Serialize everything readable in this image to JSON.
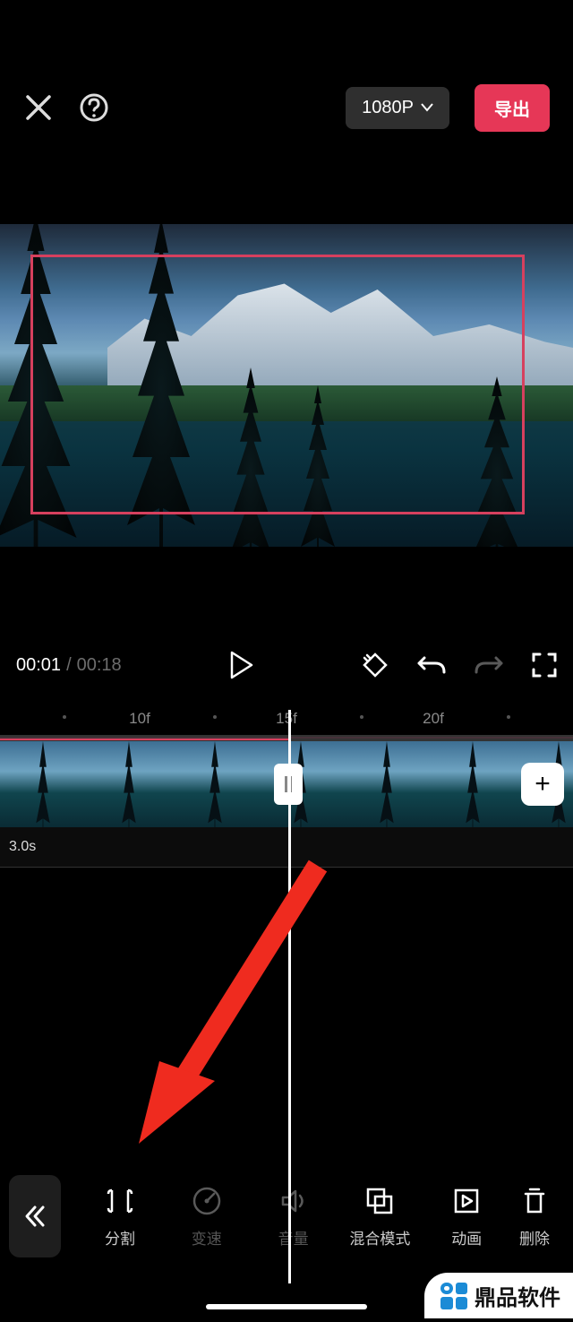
{
  "header": {
    "resolution": "1080P",
    "export_label": "导出"
  },
  "playback": {
    "current": "00:01",
    "separator": "/",
    "total": "00:18"
  },
  "ruler": {
    "t1": "10f",
    "t2": "15f",
    "t3": "20f"
  },
  "tracks": {
    "secondary_duration": "3.0s"
  },
  "toolbar": {
    "split": "分割",
    "speed": "变速",
    "volume": "音量",
    "blend": "混合模式",
    "animation": "动画",
    "delete": "删除"
  },
  "watermark": {
    "text": "鼎品软件"
  }
}
